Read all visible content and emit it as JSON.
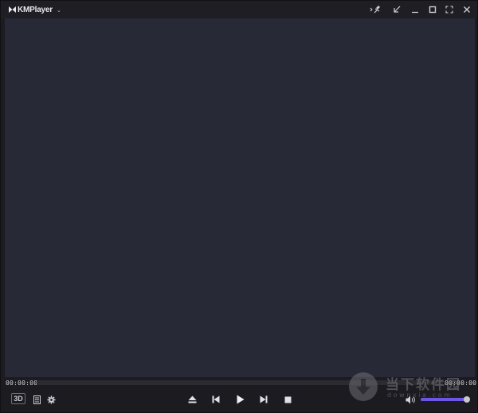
{
  "app": {
    "title": "KMPlayer",
    "title_caret": "⌄"
  },
  "titlebar": {
    "buttons": [
      "more-pin",
      "restore-down",
      "minimize",
      "maximize",
      "fullscreen",
      "close"
    ]
  },
  "playback": {
    "elapsed": "00:00:00",
    "total": "00:00:00",
    "progress": 0
  },
  "controls": {
    "three_d_label": "3D",
    "buttons": [
      "playlist",
      "settings",
      "eject",
      "previous",
      "play",
      "next",
      "stop",
      "volume"
    ]
  },
  "volume": {
    "level": 0.96
  },
  "watermark": {
    "cn": "当下软件园",
    "en": "downxia.com"
  },
  "colors": {
    "window_bg": "#1b1b20",
    "video_bg": "#272937",
    "accent": "#6b56e6",
    "icon": "#d4d4dc"
  }
}
